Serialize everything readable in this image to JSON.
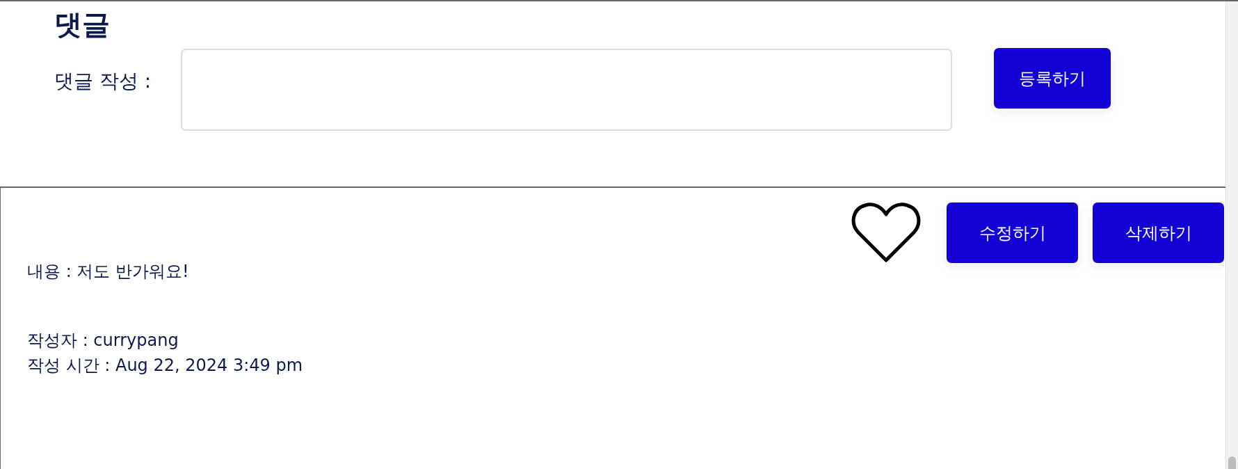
{
  "comments_section": {
    "title": "댓글",
    "form": {
      "label": "댓글 작성 :",
      "submit_button": "등록하기"
    }
  },
  "comment": {
    "liked": false,
    "edit_button": "수정하기",
    "delete_button": "삭제하기",
    "content": "내용 : 저도 반가워요!",
    "author": "작성자 : currypang",
    "time": "작성 시간 : Aug 22, 2024 3:49 pm"
  }
}
